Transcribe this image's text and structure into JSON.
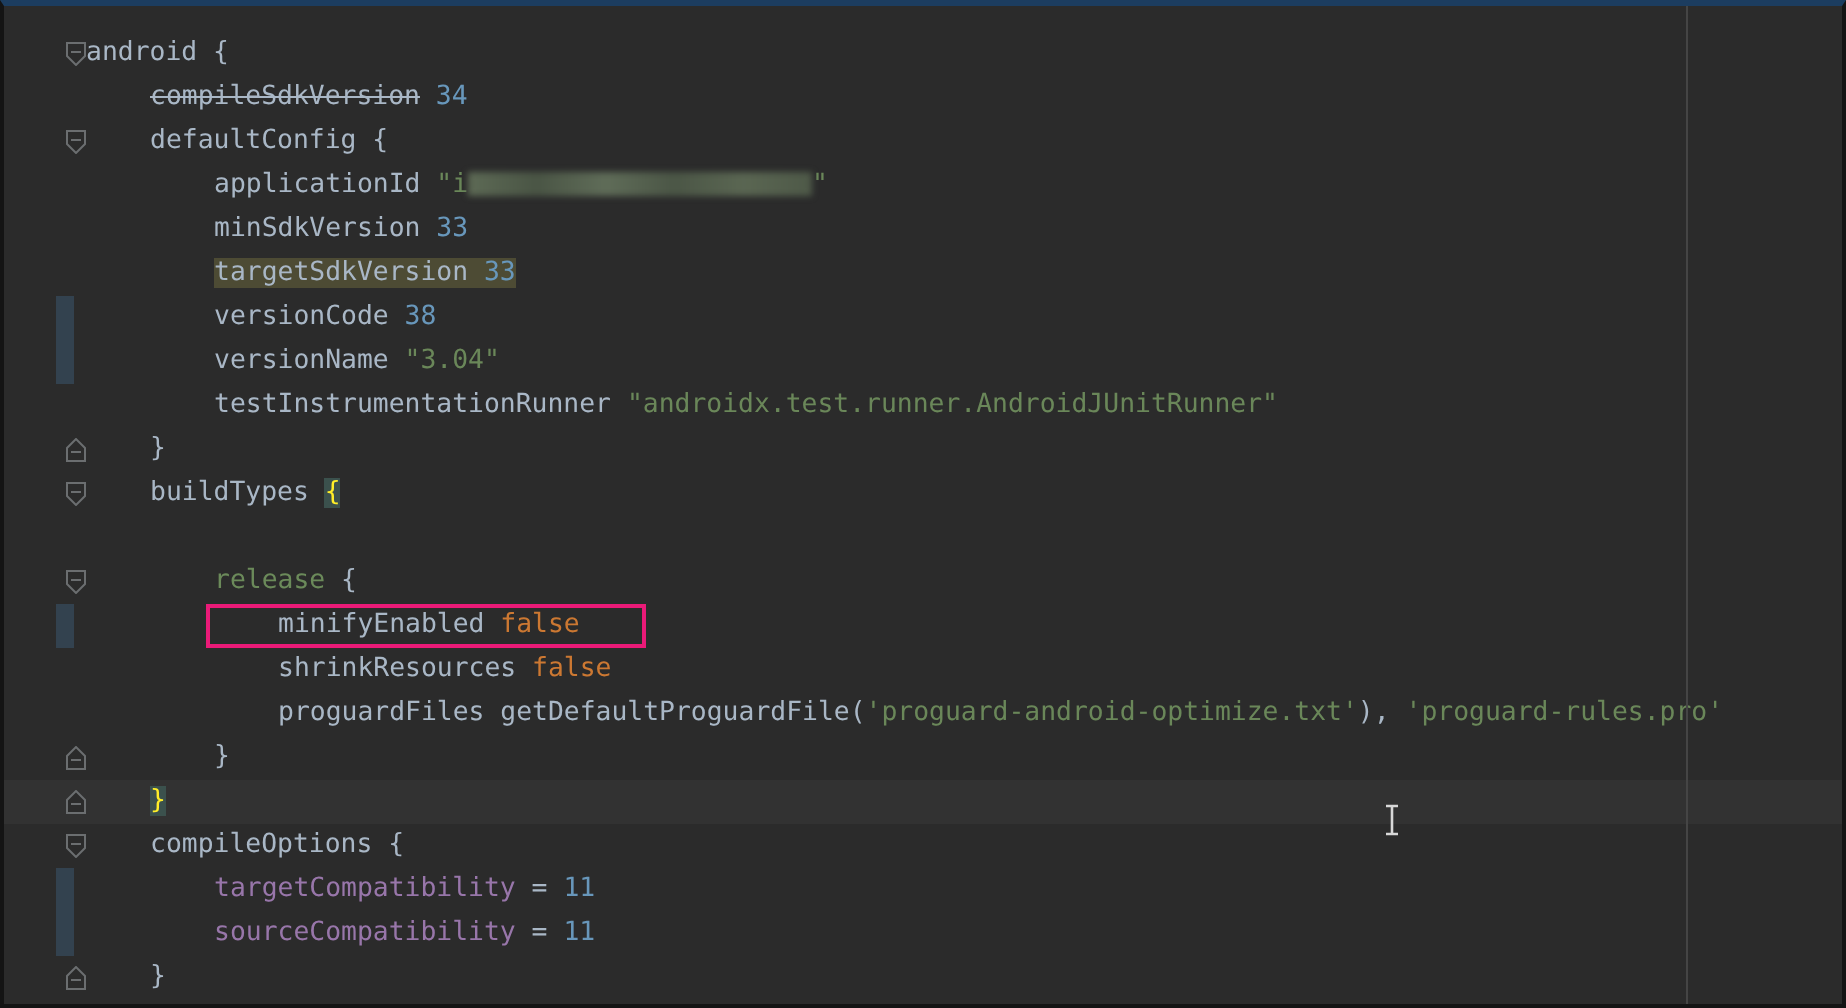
{
  "code": [
    {
      "kind": "code",
      "fold_start": true,
      "tokens": [
        {
          "text": "android",
          "kind": "plain"
        },
        {
          "text": "{",
          "kind": "plain"
        }
      ],
      "children": [
        {
          "kind": "code",
          "tokens": [
            {
              "text": "compileSdkVersion",
              "kind": "deprecated"
            },
            {
              "text": "34",
              "kind": "number"
            }
          ]
        },
        {
          "kind": "code",
          "fold_start": true,
          "tokens": [
            {
              "text": "defaultConfig",
              "kind": "plain"
            },
            {
              "text": "{",
              "kind": "plain"
            }
          ],
          "children": [
            {
              "kind": "code",
              "tokens": [
                {
                  "text": "applicationId",
                  "kind": "plain"
                },
                {
                  "text": "\"i",
                  "kind": "string"
                },
                {
                  "kind": "redacted"
                },
                {
                  "text": "\"",
                  "kind": "string",
                  "attached": true
                }
              ]
            },
            {
              "kind": "code",
              "tokens": [
                {
                  "text": "minSdkVersion",
                  "kind": "plain"
                },
                {
                  "text": "33",
                  "kind": "number"
                }
              ]
            },
            {
              "kind": "code",
              "highlighted": true,
              "tokens": [
                {
                  "text": "targetSdkVersion",
                  "kind": "plain"
                },
                {
                  "text": "33",
                  "kind": "number"
                }
              ]
            },
            {
              "kind": "code",
              "changed": true,
              "tokens": [
                {
                  "text": "versionCode",
                  "kind": "plain"
                },
                {
                  "text": "38",
                  "kind": "number"
                }
              ]
            },
            {
              "kind": "code",
              "changed": true,
              "tokens": [
                {
                  "text": "versionName",
                  "kind": "plain"
                },
                {
                  "text": "\"3.04\"",
                  "kind": "string"
                }
              ]
            },
            {
              "kind": "code",
              "tokens": [
                {
                  "text": "testInstrumentationRunner",
                  "kind": "plain"
                },
                {
                  "text": "\"androidx.test.runner.AndroidJUnitRunner\"",
                  "kind": "string"
                }
              ]
            }
          ]
        },
        {
          "kind": "code",
          "fold_end": true,
          "tokens": [
            {
              "text": "}",
              "kind": "plain"
            }
          ]
        },
        {
          "kind": "code",
          "fold_start": true,
          "tokens": [
            {
              "text": "buildTypes",
              "kind": "plain"
            },
            {
              "text": "{",
              "kind": "plain",
              "matched": true
            }
          ],
          "children": [
            {
              "kind": "blank"
            },
            {
              "kind": "code",
              "fold_start": true,
              "tokens": [
                {
                  "text": "release",
                  "kind": "block"
                },
                {
                  "text": "{",
                  "kind": "plain"
                }
              ],
              "children": [
                {
                  "kind": "code",
                  "changed": true,
                  "boxed": true,
                  "tokens": [
                    {
                      "text": "minifyEnabled",
                      "kind": "plain"
                    },
                    {
                      "text": "false",
                      "kind": "keyword"
                    }
                  ]
                },
                {
                  "kind": "code",
                  "tokens": [
                    {
                      "text": "shrinkResources",
                      "kind": "plain"
                    },
                    {
                      "text": "false",
                      "kind": "keyword"
                    }
                  ]
                },
                {
                  "kind": "code",
                  "tokens": [
                    {
                      "text": "proguardFiles",
                      "kind": "plain"
                    },
                    {
                      "text": "getDefaultProguardFile(",
                      "kind": "plain"
                    },
                    {
                      "text": "'proguard-android-optimize.txt'",
                      "kind": "string",
                      "attached": true
                    },
                    {
                      "text": "),",
                      "kind": "plain",
                      "attached": true
                    },
                    {
                      "text": "'proguard-rules.pro'",
                      "kind": "string"
                    }
                  ]
                }
              ]
            },
            {
              "kind": "code",
              "fold_end": true,
              "tokens": [
                {
                  "text": "}",
                  "kind": "plain"
                }
              ]
            }
          ]
        },
        {
          "kind": "code",
          "fold_end": true,
          "current": true,
          "tokens": [
            {
              "text": "}",
              "kind": "plain",
              "matched": true
            }
          ]
        },
        {
          "kind": "code",
          "fold_start": true,
          "tokens": [
            {
              "text": "compileOptions",
              "kind": "plain"
            },
            {
              "text": "{",
              "kind": "plain"
            }
          ],
          "children": [
            {
              "kind": "code",
              "changed": true,
              "tokens": [
                {
                  "text": "targetCompatibility",
                  "kind": "property"
                },
                {
                  "text": "=",
                  "kind": "plain"
                },
                {
                  "text": "11",
                  "kind": "number"
                }
              ]
            },
            {
              "kind": "code",
              "changed": true,
              "tokens": [
                {
                  "text": "sourceCompatibility",
                  "kind": "property"
                },
                {
                  "text": "=",
                  "kind": "plain"
                },
                {
                  "text": "11",
                  "kind": "number"
                }
              ]
            }
          ]
        },
        {
          "kind": "code",
          "fold_end": true,
          "tokens": [
            {
              "text": "}",
              "kind": "plain"
            }
          ]
        }
      ]
    }
  ]
}
